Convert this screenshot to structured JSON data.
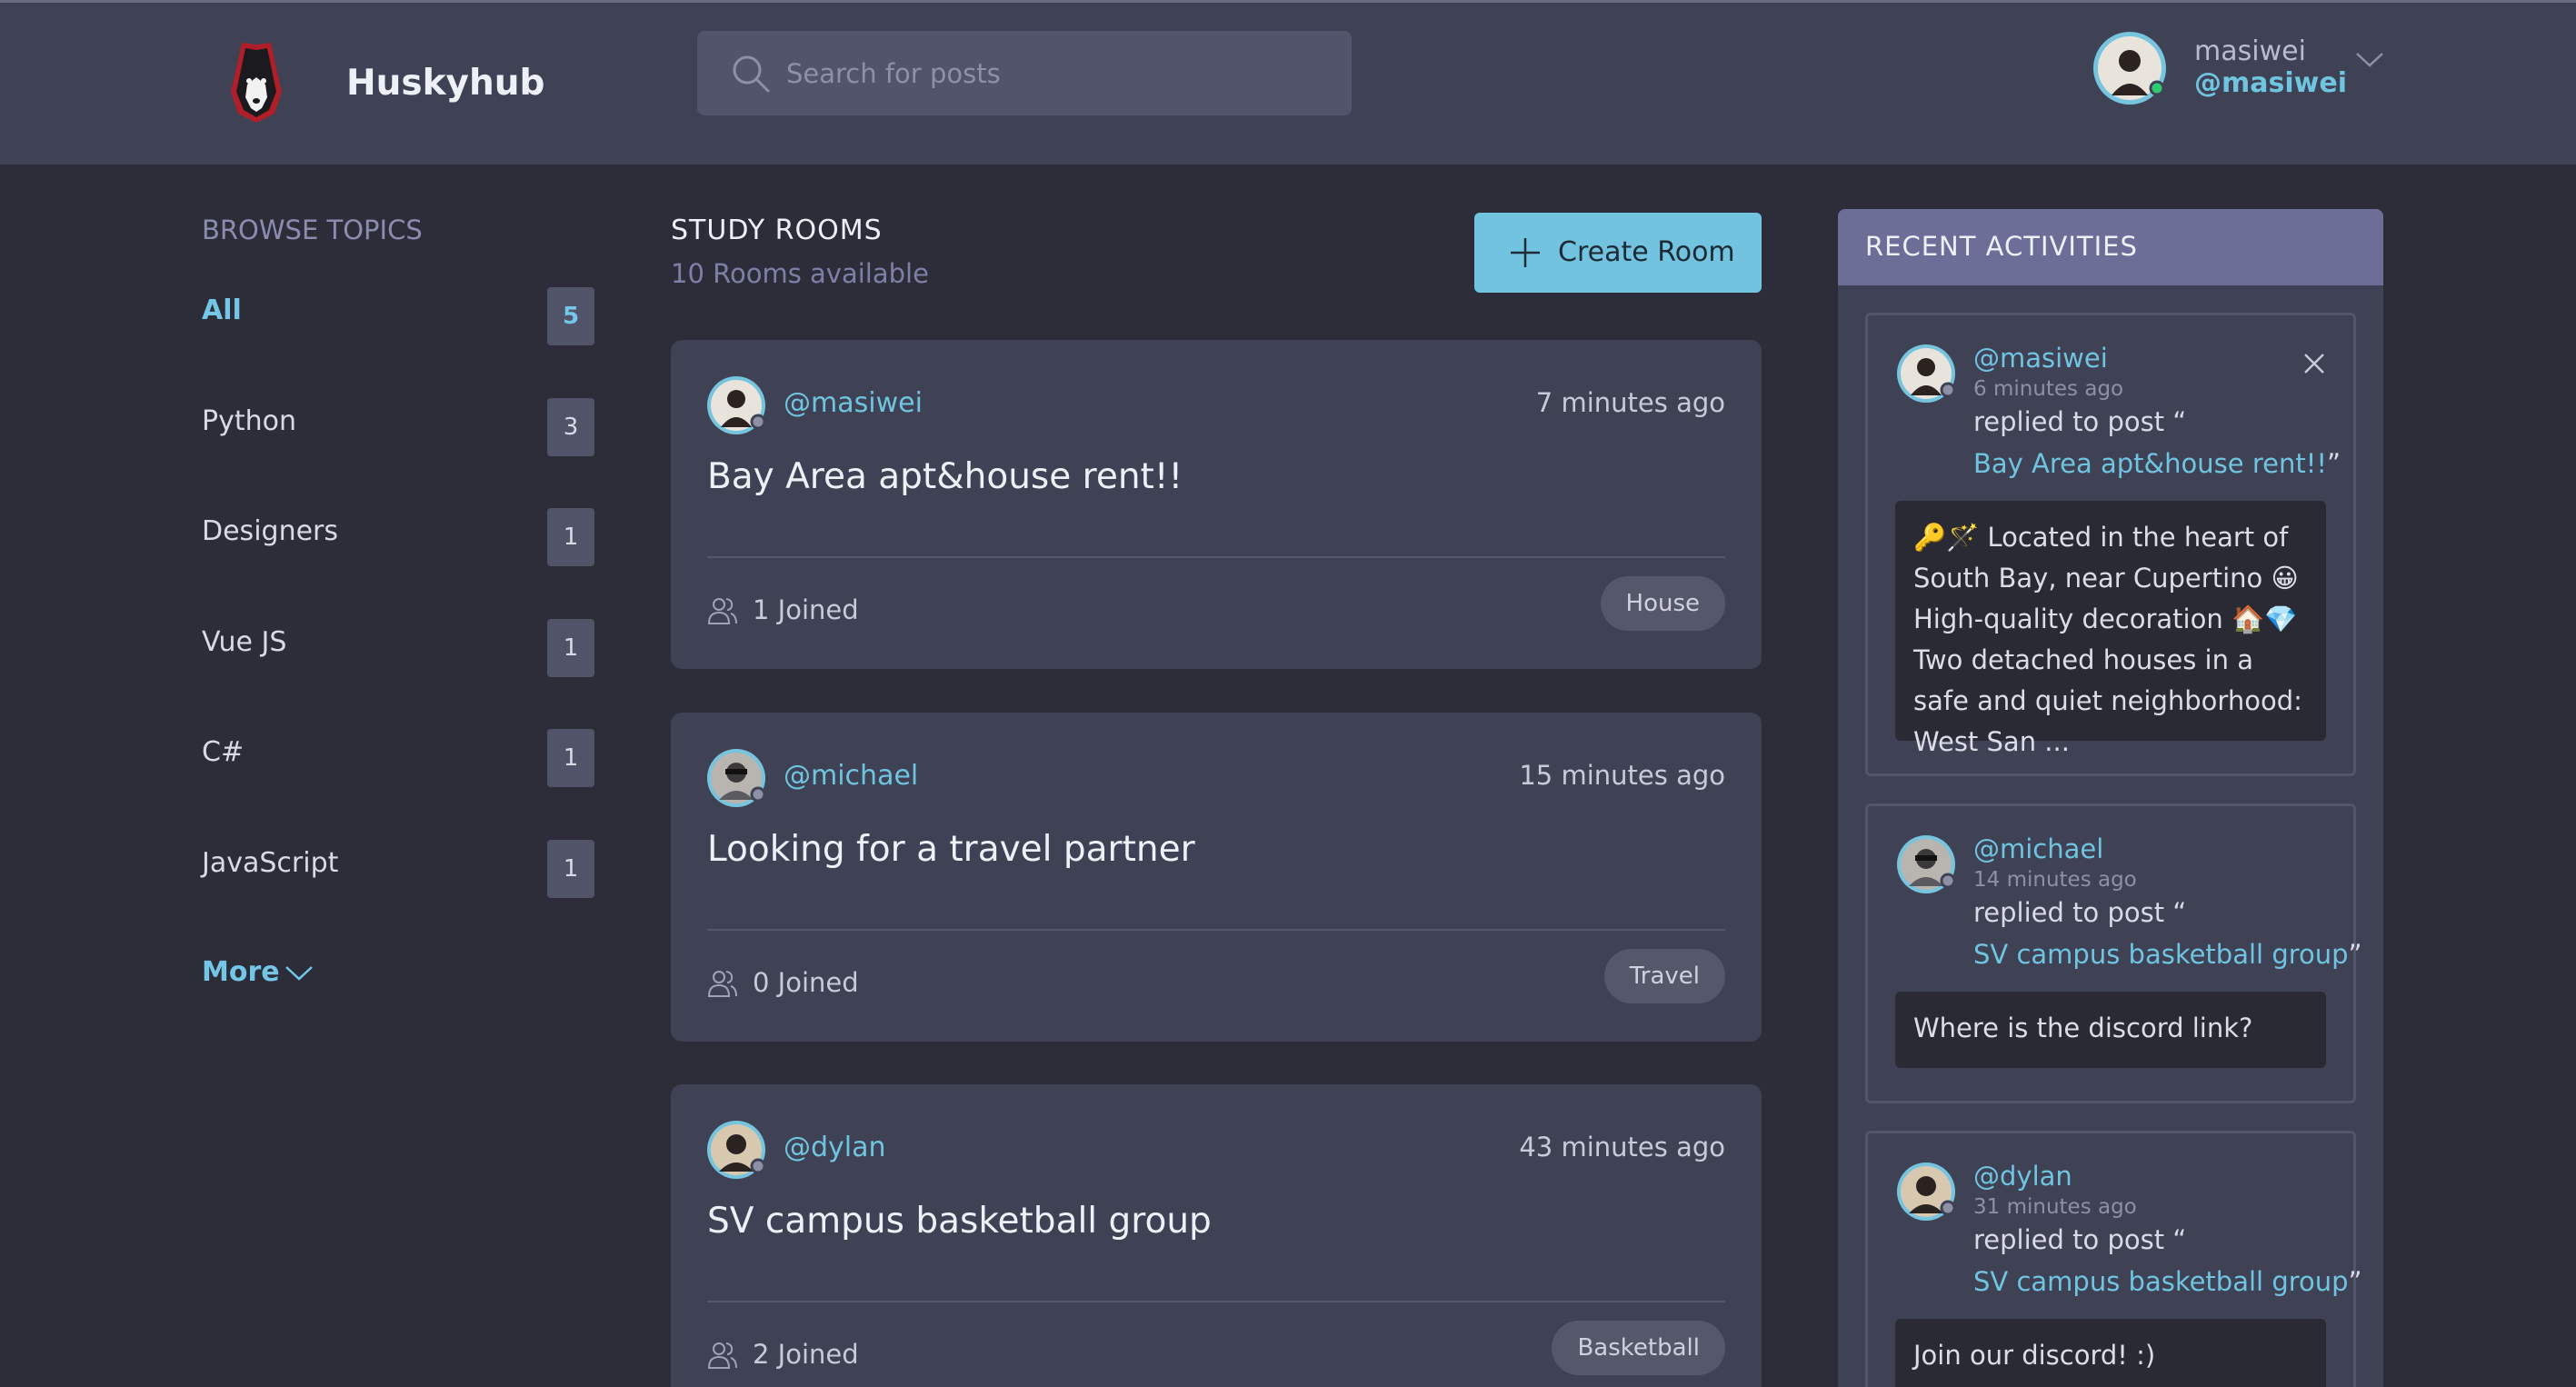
{
  "header": {
    "brand": "Huskyhub",
    "search_placeholder": "Search for posts",
    "user": {
      "name": "masiwei",
      "handle": "@masiwei"
    }
  },
  "sidebar": {
    "title": "BROWSE TOPICS",
    "topics": [
      {
        "label": "All",
        "count": "5",
        "active": true
      },
      {
        "label": "Python",
        "count": "3"
      },
      {
        "label": "Designers",
        "count": "1"
      },
      {
        "label": "Vue JS",
        "count": "1"
      },
      {
        "label": "C#",
        "count": "1"
      },
      {
        "label": "JavaScript",
        "count": "1"
      }
    ],
    "more_label": "More"
  },
  "rooms": {
    "title": "STUDY ROOMS",
    "subtitle": "10 Rooms available",
    "create_label": "Create Room",
    "items": [
      {
        "handle": "@masiwei",
        "time": "7 minutes ago",
        "title": "Bay Area apt&house rent!!",
        "joined": "1 Joined",
        "tag": "House"
      },
      {
        "handle": "@michael",
        "time": "15 minutes ago",
        "title": "Looking for a travel partner",
        "joined": "0 Joined",
        "tag": "Travel"
      },
      {
        "handle": "@dylan",
        "time": "43 minutes ago",
        "title": "SV campus basketball group",
        "joined": "2 Joined",
        "tag": "Basketball"
      }
    ]
  },
  "activities": {
    "title": "RECENT ACTIVITIES",
    "replied_text": "replied to post “",
    "close_quote": "”",
    "items": [
      {
        "handle": "@masiwei",
        "time": "6 minutes ago",
        "post": "Bay Area apt&house rent!!",
        "body": "🔑🪄 Located in the heart of South Bay, near Cupertino 😀 High-quality decoration 🏠💎 Two detached houses in a safe and quiet neighborhood: West San ..."
      },
      {
        "handle": "@michael",
        "time": "14 minutes ago",
        "post": "SV campus basketball group",
        "body": "Where is the discord link?"
      },
      {
        "handle": "@dylan",
        "time": "31 minutes ago",
        "post": "SV campus basketball group",
        "body": "Join our discord! :)"
      }
    ]
  },
  "colors": {
    "accent": "#71c3df",
    "background": "#2d2d39",
    "card": "#3f4155",
    "activity_header": "#6d6e97"
  },
  "icons": [
    "husky-logo-icon",
    "search-icon",
    "chevron-down-icon",
    "plus-icon",
    "people-icon",
    "close-icon",
    "avatar"
  ]
}
